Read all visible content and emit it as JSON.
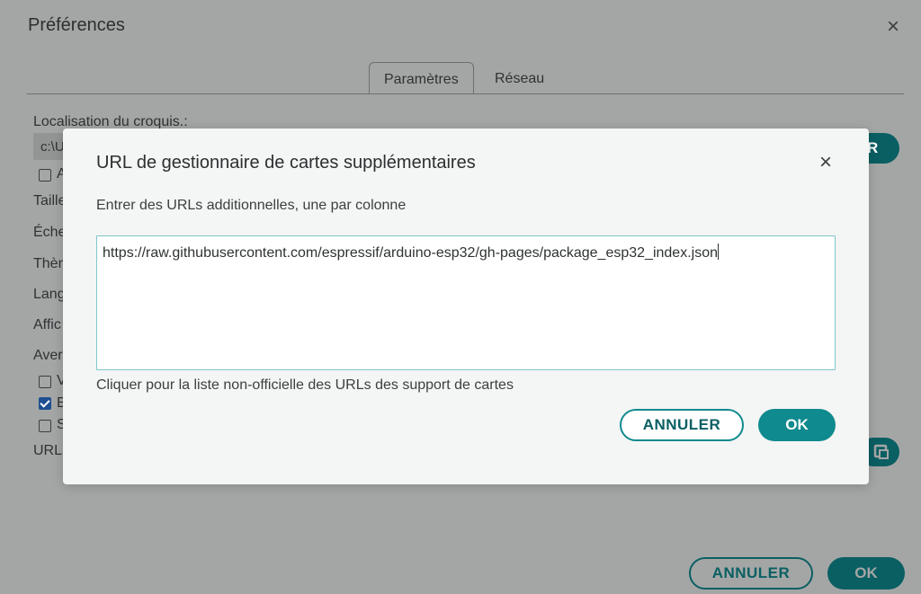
{
  "background": {
    "title": "Préférences",
    "close_icon": "×",
    "tabs": [
      {
        "label": "Paramètres",
        "active": true
      },
      {
        "label": "Réseau",
        "active": false
      }
    ],
    "sketch_location_label": "Localisation du croquis.:",
    "sketch_location_value": "c:\\U",
    "partial_labels": [
      "Taille",
      "Échel",
      "Thèm",
      "Lang",
      "Affic",
      "Aver"
    ],
    "checkbox_letters": [
      "A",
      "V",
      "E",
      "S"
    ],
    "url_label_partial": "URL",
    "browse_button_partial": "R",
    "url_edit_icon": "edit-icon",
    "cancel_label": "ANNULER",
    "ok_label": "OK"
  },
  "modal": {
    "title": "URL de gestionnaire de cartes supplémentaires",
    "close_icon": "×",
    "description": "Entrer des URLs additionnelles, une par colonne",
    "urls_value": "https://raw.githubusercontent.com/espressif/arduino-esp32/gh-pages/package_esp32_index.json",
    "unofficial_list_link": "Cliquer pour la liste non-officielle des URLs des support de cartes",
    "cancel_label": "ANNULER",
    "ok_label": "OK"
  },
  "colors": {
    "accent": "#0f8a8e",
    "accent_dark": "#0a5f63",
    "overlay": "#a4a6a6",
    "modal_bg": "#f4f5f5"
  }
}
